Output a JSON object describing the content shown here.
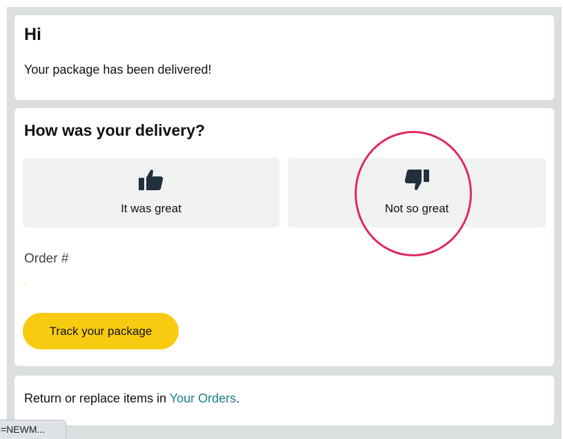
{
  "greeting": {
    "title": "Hi",
    "message": "Your package has been delivered!"
  },
  "feedback": {
    "title": "How was your delivery?",
    "options": [
      {
        "label": "It was great",
        "icon": "thumbs-up-icon"
      },
      {
        "label": "Not so great",
        "icon": "thumbs-down-icon"
      }
    ]
  },
  "order": {
    "label": "Order #",
    "number": "."
  },
  "track_button": {
    "label": "Track your package"
  },
  "returns": {
    "text": "Return or replace items in ",
    "link_text": "Your Orders",
    "trailing": "."
  },
  "status_bar": {
    "text": "=NEWM..."
  },
  "colors": {
    "accent_yellow": "#f7cc10",
    "link_teal": "#1a7f8a",
    "annotation_red": "#e0285d"
  }
}
